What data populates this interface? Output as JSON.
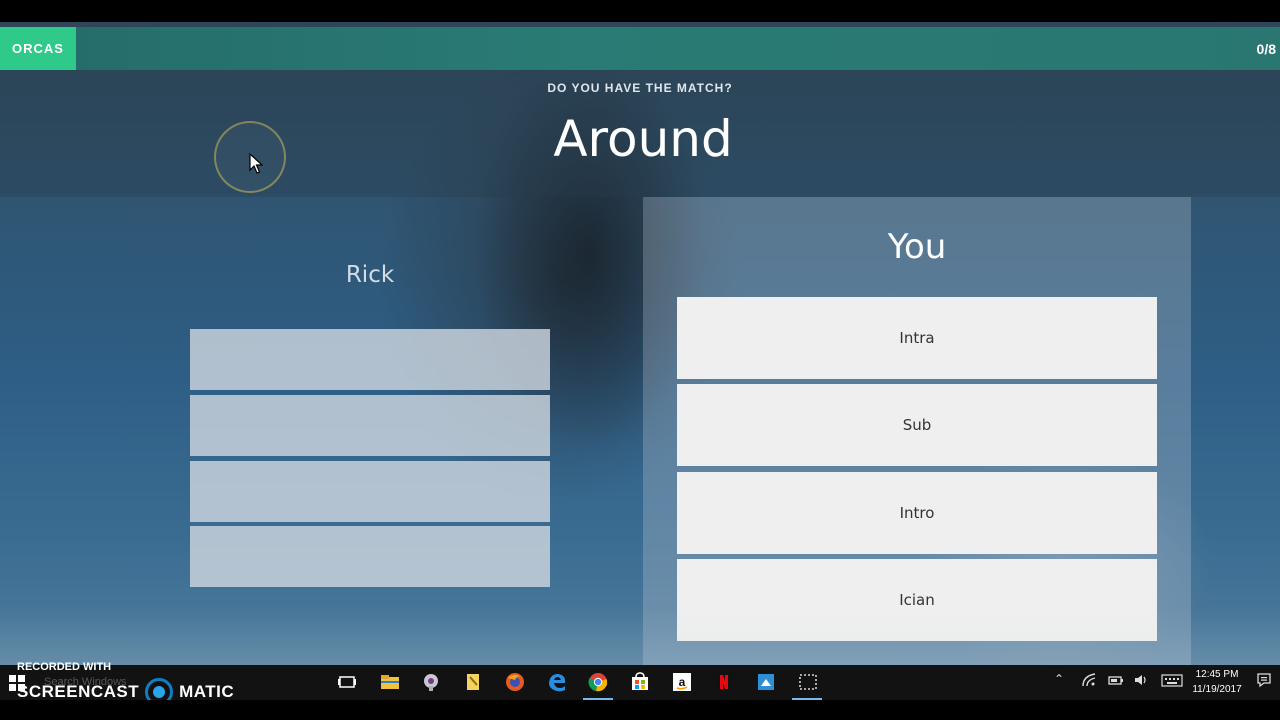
{
  "deck": {
    "name": "ORCAS",
    "score": "0/8"
  },
  "question": {
    "prompt": "DO YOU HAVE THE MATCH?",
    "word": "Around"
  },
  "opponent": {
    "name": "Rick",
    "slots": 4
  },
  "player": {
    "name": "You",
    "options": [
      "Intra",
      "Sub",
      "Intro",
      "Ician"
    ]
  },
  "recorder": {
    "line1": "RECORDED WITH",
    "brand_left": "SCREENCAST",
    "brand_right": "MATIC"
  },
  "taskbar": {
    "search_placeholder": "Search Windows",
    "time": "12:45 PM",
    "date": "11/19/2017"
  },
  "colors": {
    "deck_tag": "#2fc98a",
    "header_strip": "#2a7b75",
    "option_bg": "#efefef"
  }
}
